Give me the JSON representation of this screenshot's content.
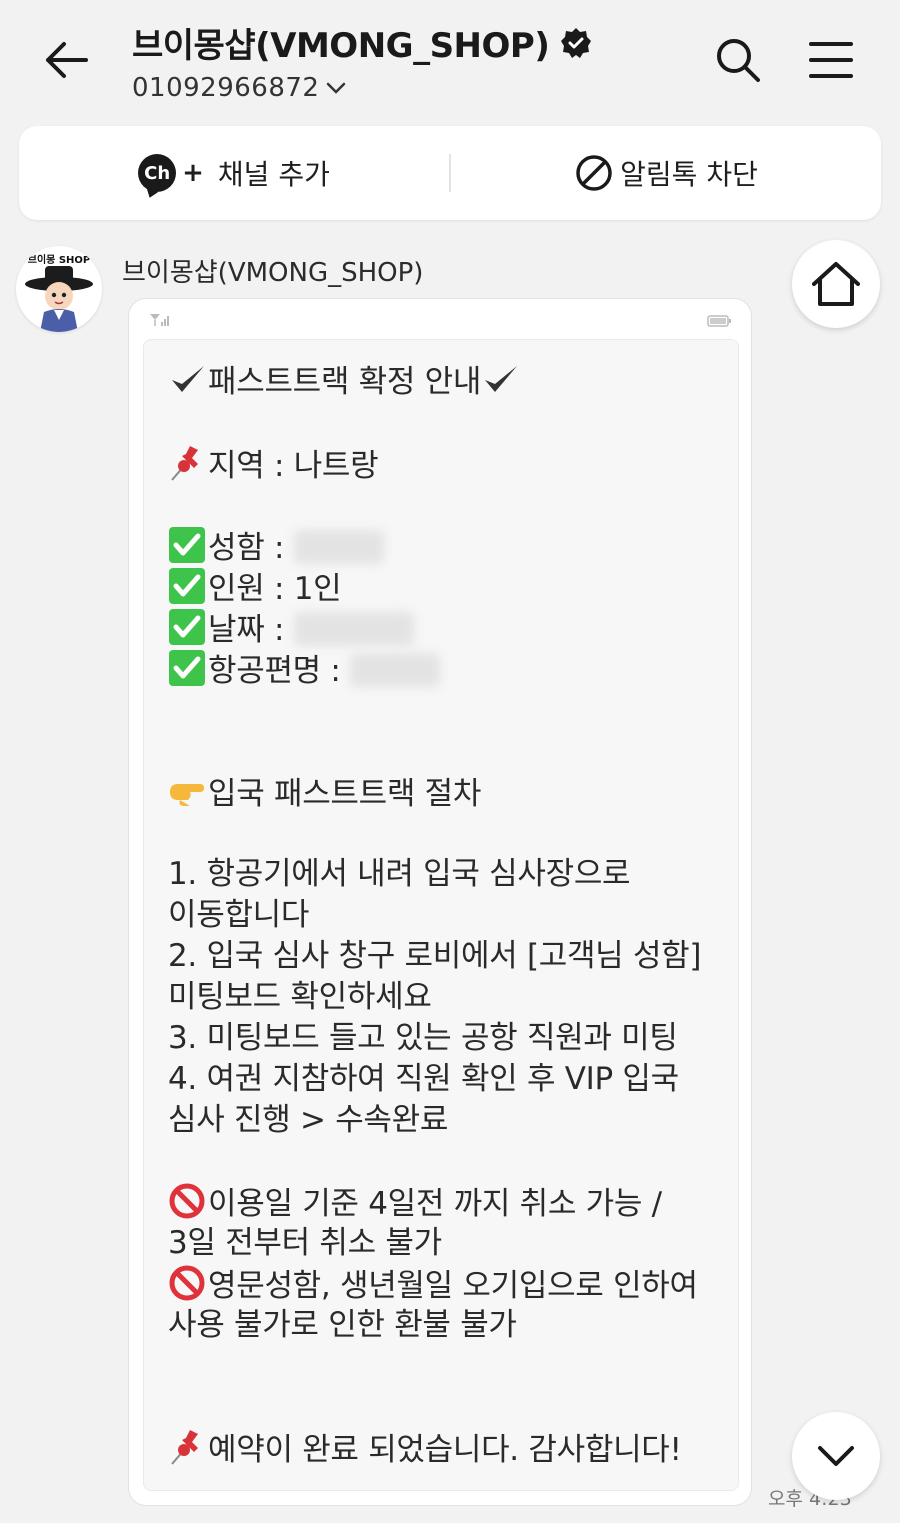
{
  "header": {
    "title": "브이몽샵(VMONG_SHOP)",
    "phone": "01092966872"
  },
  "actions": {
    "add_channel": "채널 추가",
    "block_alert": "알림톡 차단",
    "ch_badge": "Ch",
    "plus": "+"
  },
  "avatar": {
    "text": "브이몽 SHOP"
  },
  "sender": "브이몽샵(VMONG_SHOP)",
  "message": {
    "heading": "패스트트랙 확정 안내",
    "region": "지역 : 나트랑",
    "name_label": "성함 :",
    "people": "인원 : 1인",
    "date_label": "날짜 :",
    "flight_label": "항공편명 :",
    "procedure_title": "입국 패스트트랙 절차",
    "steps": [
      "1. 항공기에서 내려 입국 심사장으로",
      "이동합니다",
      "2. 입국 심사 창구 로비에서 [고객님 성함]",
      "미팅보드 확인하세요",
      "3. 미팅보드 들고 있는 공항 직원과 미팅",
      "4. 여권 지참하여 직원 확인 후 VIP 입국",
      "심사 진행 > 수속완료"
    ],
    "notice1_a": "이용일 기준 4일전 까지 취소 가능 /",
    "notice1_b": "3일 전부터 취소 불가",
    "notice2_a": "영문성함, 생년월일 오기입으로 인하여",
    "notice2_b": "사용 불가로 인한 환불 불가",
    "closing": "예약이 완료 되었습니다. 감사합니다!"
  },
  "time": "오후 4:23",
  "colors": {
    "check_green": "#3fc44b",
    "prohibit_red": "#e0323a",
    "pin_red": "#d9333a"
  }
}
